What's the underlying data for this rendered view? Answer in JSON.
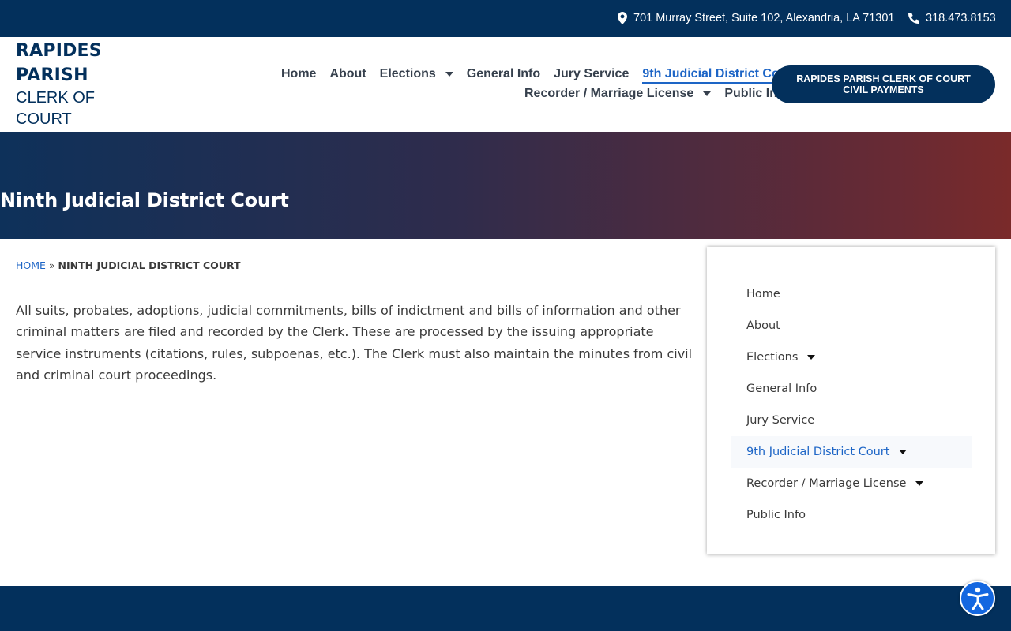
{
  "topbar": {
    "address": "701 Murray Street, Suite 102, Alexandria, LA 71301",
    "phone": "318.473.8153"
  },
  "logo": {
    "line1": "RAPIDES",
    "line2": "PARISH",
    "line3": "CLERK OF",
    "line4": "COURT"
  },
  "nav": {
    "home": "Home",
    "about": "About",
    "elections": "Elections",
    "general_info": "General Info",
    "jury_service": "Jury Service",
    "district_court": "9th Judicial District Court",
    "recorder": "Recorder / Marriage License",
    "public_info": "Public Info"
  },
  "pay_button": "RAPIDES PARISH CLERK OF COURT CIVIL PAYMENTS",
  "hero": {
    "title": "Ninth Judicial District Court"
  },
  "breadcrumb": {
    "home": "HOME",
    "separator": "»",
    "current": "NINTH JUDICIAL DISTRICT COURT"
  },
  "content": {
    "paragraph": "All suits, probates, adoptions, judicial commitments, bills of indictment and bills of information and other criminal matters are filed and recorded by the Clerk. These are processed by the issuing appropriate service instruments (citations, rules, subpoenas, etc.). The Clerk must also maintain the minutes from civil and criminal court proceedings."
  },
  "sidebar": {
    "items": [
      {
        "label": "Home"
      },
      {
        "label": "About"
      },
      {
        "label": "Elections"
      },
      {
        "label": "General Info"
      },
      {
        "label": "Jury Service"
      },
      {
        "label": "9th Judicial District Court"
      },
      {
        "label": "Recorder / Marriage License"
      },
      {
        "label": "Public Info"
      }
    ]
  },
  "colors": {
    "navy": "#03305c",
    "accent_blue": "#1d65c6",
    "hero_left": "#0e315a",
    "hero_right": "#7a2a2a"
  },
  "icons": {
    "address": "map-pin-icon",
    "phone": "phone-icon",
    "accessibility": "accessibility-icon"
  }
}
